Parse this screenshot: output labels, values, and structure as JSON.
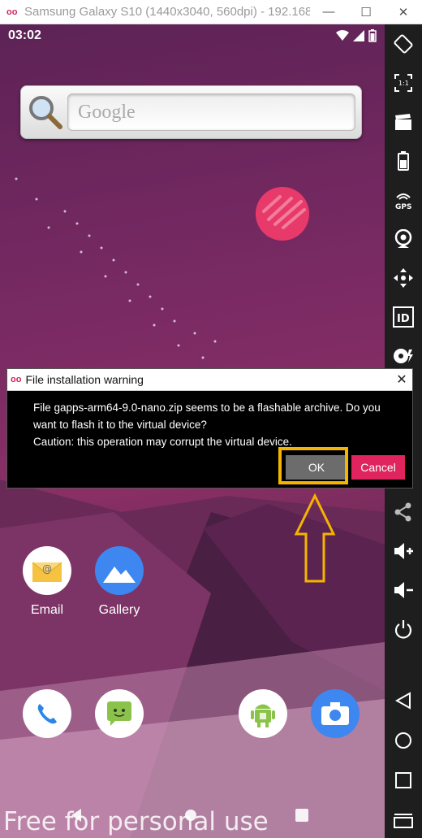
{
  "window": {
    "title": "Samsung Galaxy S10 (1440x3040, 560dpi) - 192.168....",
    "minimize": "—",
    "maximize": "☐",
    "close": "✕"
  },
  "statusbar": {
    "time": "03:02"
  },
  "search_widget": {
    "placeholder": "Google"
  },
  "apps": [
    {
      "label": "Email"
    },
    {
      "label": "Gallery"
    }
  ],
  "dialog": {
    "title": "File installation warning",
    "message_line1": "File gapps-arm64-9.0-nano.zip seems to be a flashable archive. Do you",
    "message_line2": "want to flash it to the virtual device?",
    "message_line3": "Caution: this operation may corrupt the virtual device.",
    "ok_label": "OK",
    "cancel_label": "Cancel",
    "close_glyph": "✕"
  },
  "sidebar": {
    "items": [
      "rotate",
      "fullscreen",
      "screencast",
      "battery",
      "gps",
      "camera",
      "move",
      "identity",
      "media",
      "share",
      "volume-up",
      "volume-down",
      "power",
      "back",
      "home",
      "recents",
      "menu"
    ],
    "gps_label": "GPS",
    "id_label": "ID",
    "fullscreen_label": "1:1"
  },
  "watermark": "Free for personal use",
  "colors": {
    "accent": "#e0245e",
    "highlight": "#f5b400",
    "toolbar": "#1e1e1e"
  }
}
